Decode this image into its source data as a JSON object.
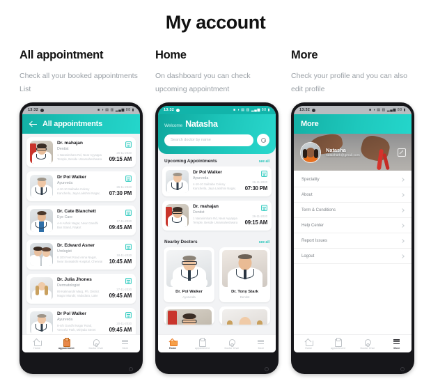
{
  "page": {
    "title": "My account"
  },
  "columns": [
    {
      "title": "All appointment",
      "subtitle": "Check all your booked appointments List"
    },
    {
      "title": "Home",
      "subtitle": "On dashboard you can check upcoming appointment"
    },
    {
      "title": "More",
      "subtitle": "Check your profile and you can also edit profile"
    }
  ],
  "status_bar": {
    "time": "13:32",
    "icons": "■ ◑ ▤ ▥ ▂▄▆ 88 ▮"
  },
  "phone1": {
    "appbar": {
      "title": "All appointments",
      "back_icon": "arrow-left-icon"
    },
    "appointments": [
      {
        "name": "Dr. mahajan",
        "speciality": "Dentist",
        "description": "1 Narasimham Rd, Near Ayyappa Temple, Beside Umamaheshwara",
        "date": "26-11-2020",
        "time": "09:15 AM"
      },
      {
        "name": "Dr Pol Walker",
        "speciality": "Ayurveda",
        "description": "4-10-10 Saibaba Colony Kancherla, Jaya Lakshmi Nagar, Tirupa...",
        "date": "26-11-2020",
        "time": "07:30 PM"
      },
      {
        "name": "Dr. Cate Blanchett",
        "speciality": "Eye Care",
        "description": "A-6 Ashok Nagar, Near Gandhi Bus Stand, Rajkot",
        "date": "17-11-2020",
        "time": "09:45 AM"
      },
      {
        "name": "Dr. Edward Asner",
        "speciality": "Urologist",
        "description": "8 100 Feet Road Anna Nagar, Near Sivasakthi Hospital, Chennai",
        "date": "18-11-2020",
        "time": "10:45 AM"
      },
      {
        "name": "Dr. Julia Jhones",
        "speciality": "Dermatologist",
        "description": "89 Kalimandir Marg, Ph. District Magar Mandir, Vadodara, Lake",
        "date": "27-11-2020",
        "time": "09:45 AM"
      },
      {
        "name": "Dr Pol Walker",
        "speciality": "Ayurveda",
        "description": "8-4/5 Gandhi Nagar Road, Vennela Park, Miriyala Street",
        "date": "20-11-2020",
        "time": "09:45 AM"
      }
    ],
    "bottom_nav": [
      {
        "label": "Home",
        "icon": "home-icon",
        "active": false
      },
      {
        "label": "appointment",
        "icon": "clipboard-icon",
        "active": true
      },
      {
        "label": "Doctor Chat",
        "icon": "chat-icon",
        "active": false
      },
      {
        "label": "More",
        "icon": "hamburger-icon",
        "active": false
      }
    ]
  },
  "phone2": {
    "welcome_prefix": "Welcome",
    "welcome_name": "Natasha",
    "search": {
      "placeholder": "Search doctor by name",
      "icon": "search-icon"
    },
    "upcoming": {
      "title": "Upcoming Appointments",
      "link": "see all",
      "items": [
        {
          "name": "Dr Pol Walker",
          "speciality": "Ayurveda",
          "description": "4-10-10 Saibaba Colony Kancherla, Jaya Lakshmi Nagar, Tirupa...",
          "date": "26-11-2020",
          "time": "07:30 PM"
        },
        {
          "name": "Dr. mahajan",
          "speciality": "Dentist",
          "description": "1 Narasimham Rd, Near Ayyappa Temple, Beside Umamaheshwara",
          "date": "26-11-2020",
          "time": "09:15 AM"
        }
      ]
    },
    "nearby": {
      "title": "Nearby Doctors",
      "link": "see all",
      "items": [
        {
          "name": "Dr. Pol Walker",
          "speciality": "Ayurveda"
        },
        {
          "name": "Dr. Tony Stark",
          "speciality": "Dentist"
        }
      ]
    },
    "bottom_nav": [
      {
        "label": "Home",
        "icon": "home-icon",
        "active": true
      },
      {
        "label": "appointment",
        "icon": "clipboard-icon",
        "active": false
      },
      {
        "label": "Doctor Chat",
        "icon": "chat-icon",
        "active": false
      },
      {
        "label": "More",
        "icon": "hamburger-icon",
        "active": false
      }
    ]
  },
  "phone3": {
    "appbar": {
      "title": "More"
    },
    "profile": {
      "name": "Natasha",
      "email": "natashark@gmail.com",
      "edit_icon": "edit-pencil-icon",
      "avatar": "user-avatar"
    },
    "menu": [
      {
        "label": "Speciality"
      },
      {
        "label": "About"
      },
      {
        "label": "Term & Conditions"
      },
      {
        "label": "Help Center"
      },
      {
        "label": "Report Issues"
      },
      {
        "label": "Logout"
      }
    ],
    "bottom_nav": [
      {
        "label": "Home",
        "icon": "home-icon",
        "active": false
      },
      {
        "label": "appointment",
        "icon": "clipboard-icon",
        "active": false
      },
      {
        "label": "Doctor Chat",
        "icon": "chat-icon",
        "active": false
      },
      {
        "label": "More",
        "icon": "hamburger-icon",
        "active": true
      }
    ]
  },
  "colors": {
    "teal": "#1ec8bd",
    "teal_dark": "#13b0a5",
    "accent_orange": "#e8884a",
    "text_dark": "#1b1b1f",
    "text_muted": "#9aa0a6",
    "screen_bg": "#f2f3f5"
  }
}
